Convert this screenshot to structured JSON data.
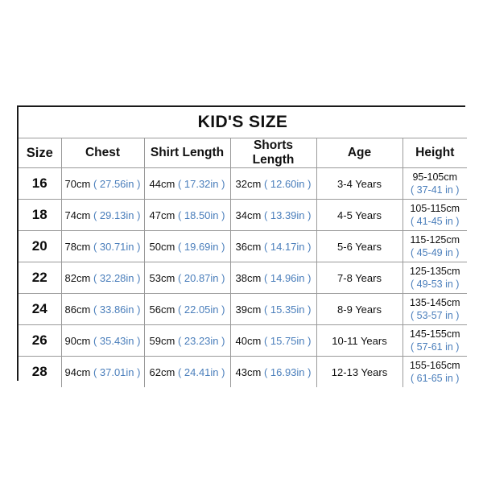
{
  "table": {
    "title": "KID'S SIZE",
    "columns": [
      {
        "key": "size",
        "label": "Size"
      },
      {
        "key": "chest",
        "label": "Chest"
      },
      {
        "key": "shirt",
        "label": "Shirt Length"
      },
      {
        "key": "shorts",
        "label": "Shorts Length"
      },
      {
        "key": "age",
        "label": "Age"
      },
      {
        "key": "height",
        "label": "Height"
      }
    ],
    "colors": {
      "imperial_text": "#4a7ebb",
      "metric_text": "#111111",
      "outer_border": "#1a1a1a",
      "inner_border": "#9a9a9a",
      "background": "#ffffff"
    },
    "rows": [
      {
        "size": "16",
        "chest_cm": "70cm",
        "chest_in": "( 27.56in )",
        "shirt_cm": "44cm",
        "shirt_in": "( 17.32in )",
        "shorts_cm": "32cm",
        "shorts_in": "( 12.60in )",
        "age": "3-4 Years",
        "height_cm": "95-105cm",
        "height_in": "( 37-41 in )"
      },
      {
        "size": "18",
        "chest_cm": "74cm",
        "chest_in": "( 29.13in )",
        "shirt_cm": "47cm",
        "shirt_in": "( 18.50in )",
        "shorts_cm": "34cm",
        "shorts_in": "( 13.39in )",
        "age": "4-5 Years",
        "height_cm": "105-115cm",
        "height_in": "( 41-45 in )"
      },
      {
        "size": "20",
        "chest_cm": "78cm",
        "chest_in": "( 30.71in )",
        "shirt_cm": "50cm",
        "shirt_in": "( 19.69in )",
        "shorts_cm": "36cm",
        "shorts_in": "( 14.17in )",
        "age": "5-6 Years",
        "height_cm": "115-125cm",
        "height_in": "( 45-49 in )"
      },
      {
        "size": "22",
        "chest_cm": "82cm",
        "chest_in": "( 32.28in )",
        "shirt_cm": "53cm",
        "shirt_in": "( 20.87in )",
        "shorts_cm": "38cm",
        "shorts_in": "( 14.96in )",
        "age": "7-8 Years",
        "height_cm": "125-135cm",
        "height_in": "( 49-53 in )"
      },
      {
        "size": "24",
        "chest_cm": "86cm",
        "chest_in": "( 33.86in )",
        "shirt_cm": "56cm",
        "shirt_in": "( 22.05in )",
        "shorts_cm": "39cm",
        "shorts_in": "( 15.35in )",
        "age": "8-9 Years",
        "height_cm": "135-145cm",
        "height_in": "( 53-57 in )"
      },
      {
        "size": "26",
        "chest_cm": "90cm",
        "chest_in": "( 35.43in )",
        "shirt_cm": "59cm",
        "shirt_in": "( 23.23in )",
        "shorts_cm": "40cm",
        "shorts_in": "( 15.75in )",
        "age": "10-11 Years",
        "height_cm": "145-155cm",
        "height_in": "( 57-61 in )"
      },
      {
        "size": "28",
        "chest_cm": "94cm",
        "chest_in": "( 37.01in )",
        "shirt_cm": "62cm",
        "shirt_in": "( 24.41in )",
        "shorts_cm": "43cm",
        "shorts_in": "( 16.93in )",
        "age": "12-13 Years",
        "height_cm": "155-165cm",
        "height_in": "( 61-65 in )"
      }
    ]
  }
}
